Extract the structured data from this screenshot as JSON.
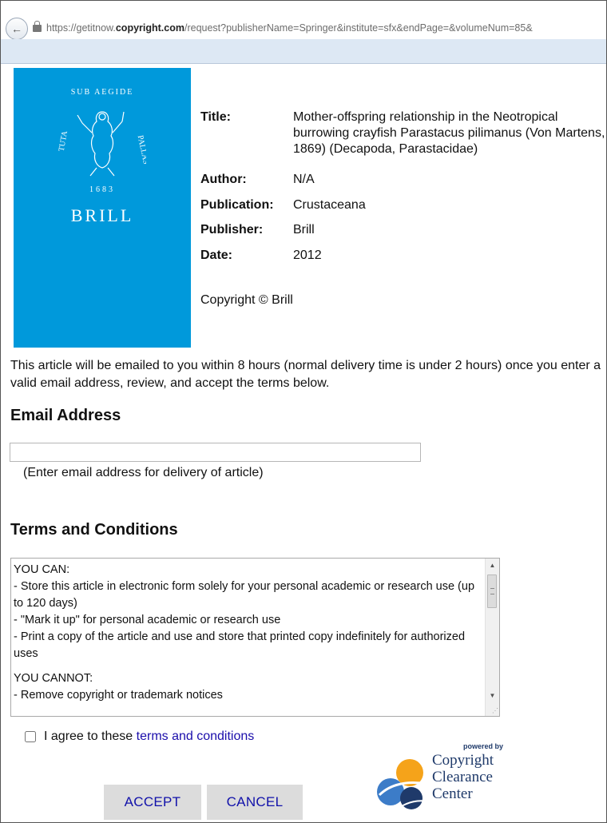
{
  "browser": {
    "url_prefix": "https://getitnow.",
    "url_domain": "copyright.com",
    "url_path": "/request?publisherName=Springer&institute=sfx&endPage=&volumeNum=85&"
  },
  "logo": {
    "brand": "BRILL",
    "seal_text": "SUB AEGIDE PALLAS TUTA 1683"
  },
  "article": {
    "title_label": "Title:",
    "title_value": "Mother-offspring relationship in the Neotropical burrowing crayfish Parastacus pilimanus (Von Martens, 1869) (Decapoda, Parastacidae)",
    "author_label": "Author:",
    "author_value": "N/A",
    "publication_label": "Publication:",
    "publication_value": "Crustaceana",
    "publisher_label": "Publisher:",
    "publisher_value": "Brill",
    "date_label": "Date:",
    "date_value": "2012",
    "copyright": "Copyright © Brill"
  },
  "intro": "This article will be emailed to you within 8 hours (normal delivery time is under 2 hours) once you enter a valid email address, review, and accept the terms below.",
  "email": {
    "heading": "Email Address",
    "value": "",
    "hint": "(Enter email address for delivery of article)"
  },
  "terms": {
    "heading": "Terms and Conditions",
    "can_heading": "YOU CAN:",
    "can_items": [
      "- Store this article in electronic form solely for your personal academic or research use (up to 120 days)",
      "- \"Mark it up\" for personal academic or research use",
      "- Print a copy of the article and use and store that printed copy indefinitely for authorized uses"
    ],
    "cannot_heading": "YOU CANNOT:",
    "cannot_items": [
      "- Remove copyright or trademark notices"
    ]
  },
  "agree": {
    "prefix": "I agree to these",
    "link": "terms and conditions",
    "checked": false
  },
  "buttons": {
    "accept": "ACCEPT",
    "cancel": "CANCEL"
  },
  "ccc": {
    "powered_by": "powered by",
    "line1": "Copyright",
    "line2": "Clearance",
    "line3": "Center"
  },
  "colors": {
    "logo_blue": "#0099db",
    "button_text": "#1111aa",
    "link": "#1a0dab",
    "ccc_navy": "#1f3a6a"
  }
}
